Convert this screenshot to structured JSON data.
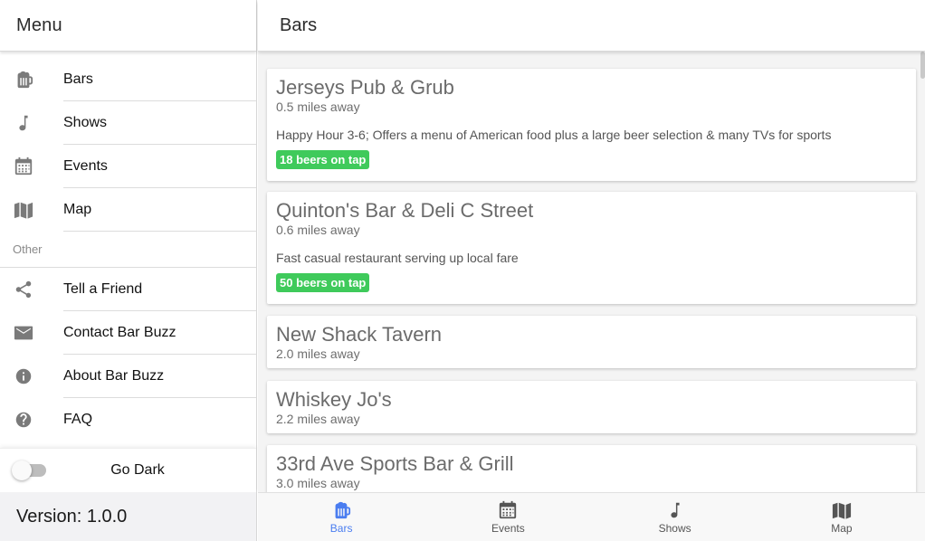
{
  "sidebar": {
    "title": "Menu",
    "items": [
      {
        "label": "Bars",
        "icon": "beer-mug-icon"
      },
      {
        "label": "Shows",
        "icon": "music-note-icon"
      },
      {
        "label": "Events",
        "icon": "calendar-icon"
      },
      {
        "label": "Map",
        "icon": "map-icon"
      }
    ],
    "section_label": "Other",
    "other_items": [
      {
        "label": "Tell a Friend",
        "icon": "share-icon"
      },
      {
        "label": "Contact Bar Buzz",
        "icon": "mail-icon"
      },
      {
        "label": "About Bar Buzz",
        "icon": "info-icon"
      },
      {
        "label": "FAQ",
        "icon": "help-icon"
      }
    ],
    "toggle_label": "Go Dark",
    "toggle_on": false,
    "version": "Version: 1.0.0"
  },
  "main": {
    "title": "Bars",
    "bars": [
      {
        "name": "Jerseys Pub & Grub",
        "distance": "0.5 miles away",
        "description": "Happy Hour 3-6; Offers a menu of American food plus a large beer selection & many TVs for sports",
        "badge": "18 beers on tap"
      },
      {
        "name": "Quinton's Bar & Deli C Street",
        "distance": "0.6 miles away",
        "description": "Fast casual restaurant serving up local fare",
        "badge": "50 beers on tap"
      },
      {
        "name": "New Shack Tavern",
        "distance": "2.0 miles away"
      },
      {
        "name": "Whiskey Jo's",
        "distance": "2.2 miles away"
      },
      {
        "name": "33rd Ave Sports Bar & Grill",
        "distance": "3.0 miles away"
      }
    ]
  },
  "tabbar": {
    "tabs": [
      {
        "label": "Bars",
        "icon": "beer-mug-icon",
        "active": true
      },
      {
        "label": "Events",
        "icon": "calendar-icon",
        "active": false
      },
      {
        "label": "Shows",
        "icon": "music-note-icon",
        "active": false
      },
      {
        "label": "Map",
        "icon": "map-icon",
        "active": false
      }
    ]
  },
  "colors": {
    "accent": "#4a7df0",
    "badge_green": "#3fca5b"
  }
}
